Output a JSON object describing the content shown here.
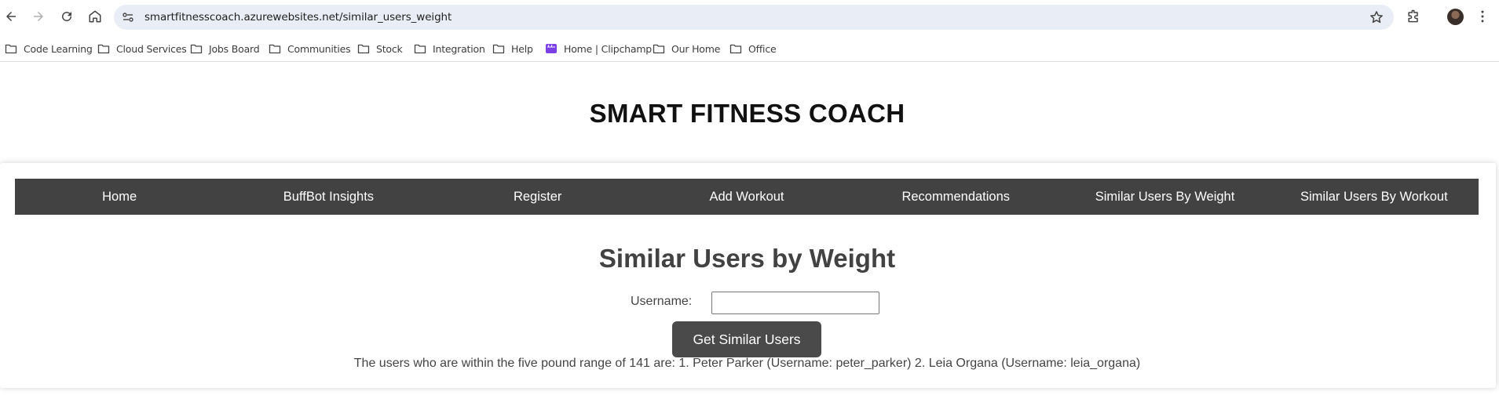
{
  "browser": {
    "url": "smartfitnesscoach.azurewebsites.net/similar_users_weight",
    "bookmarks": [
      {
        "label": "Code Learning",
        "icon": "folder-icon"
      },
      {
        "label": "Cloud Services",
        "icon": "folder-icon"
      },
      {
        "label": "Jobs Board",
        "icon": "folder-icon"
      },
      {
        "label": "Communities",
        "icon": "folder-icon"
      },
      {
        "label": "Stock",
        "icon": "folder-icon"
      },
      {
        "label": "Integration",
        "icon": "folder-icon"
      },
      {
        "label": "Help",
        "icon": "folder-icon"
      },
      {
        "label": "Home | Clipchamp",
        "icon": "clipchamp-icon"
      },
      {
        "label": "Our Home",
        "icon": "folder-icon"
      },
      {
        "label": "Office",
        "icon": "folder-icon"
      }
    ]
  },
  "site": {
    "title": "SMART FITNESS COACH",
    "nav": [
      "Home",
      "BuffBot Insights",
      "Register",
      "Add Workout",
      "Recommendations",
      "Similar Users By Weight",
      "Similar Users By Workout"
    ]
  },
  "main": {
    "heading": "Similar Users by Weight",
    "username_label": "Username:",
    "username_value": "",
    "submit_label": "Get Similar Users",
    "result": "The users who are within the five pound range of 141 are: 1. Peter Parker (Username: peter_parker) 2. Leia Organa (Username: leia_organa)"
  },
  "colors": {
    "navbar_bg": "#424242",
    "button_bg": "#4a4a4a",
    "omnibox_bg": "#e9eef6"
  }
}
